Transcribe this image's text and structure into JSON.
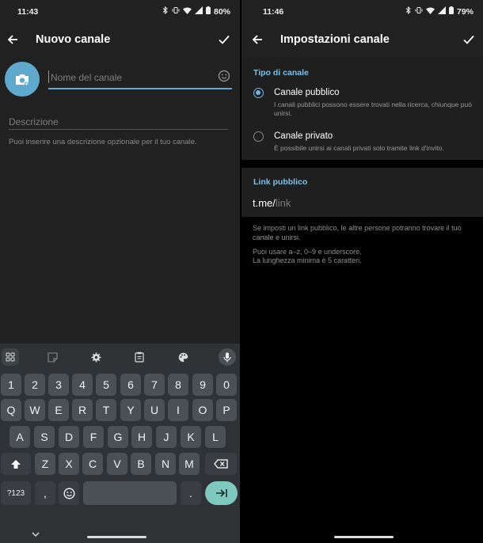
{
  "left": {
    "status": {
      "time": "11:43",
      "battery": "80%"
    },
    "title": "Nuovo canale",
    "name_placeholder": "Nome del canale",
    "description_placeholder": "Descrizione",
    "description_hint": "Puoi inserire una descrizione opzionale per il tuo canale.",
    "keyboard": {
      "row_numbers": [
        "1",
        "2",
        "3",
        "4",
        "5",
        "6",
        "7",
        "8",
        "9",
        "0"
      ],
      "row_1": [
        "Q",
        "W",
        "E",
        "R",
        "T",
        "Y",
        "U",
        "I",
        "O",
        "P"
      ],
      "row_2": [
        "A",
        "S",
        "D",
        "F",
        "G",
        "H",
        "J",
        "K",
        "L"
      ],
      "row_3": [
        "Z",
        "X",
        "C",
        "V",
        "B",
        "N",
        "M"
      ],
      "symbols_key": "?123",
      "comma_key": ",",
      "period_key": "."
    }
  },
  "right": {
    "status": {
      "time": "11:46",
      "battery": "79%"
    },
    "title": "Impostazioni canale",
    "type_section": "Tipo di canale",
    "public_title": "Canale pubblico",
    "public_desc": "I canali pubblici possono essere trovati nella ricerca, chiunque può unirsi.",
    "private_title": "Canale privato",
    "private_desc": "È possibile unirsi ai canali privati solo tramite link d'invito.",
    "selected_type": "public",
    "link_section": "Link pubblico",
    "link_prefix": "t.me/",
    "link_placeholder": "link",
    "info_1": "Se imposti un link pubblico, le altre persone potranno trovare il tuo canale e unirsi.",
    "info_2": "Puoi usare a–z, 0–9 e underscore.",
    "info_3": "La lunghezza minima è 5 caratteri."
  },
  "colors": {
    "accent": "#5fa9cf",
    "link_label": "#7fc0e4",
    "enter_key": "#7ec8bf"
  }
}
